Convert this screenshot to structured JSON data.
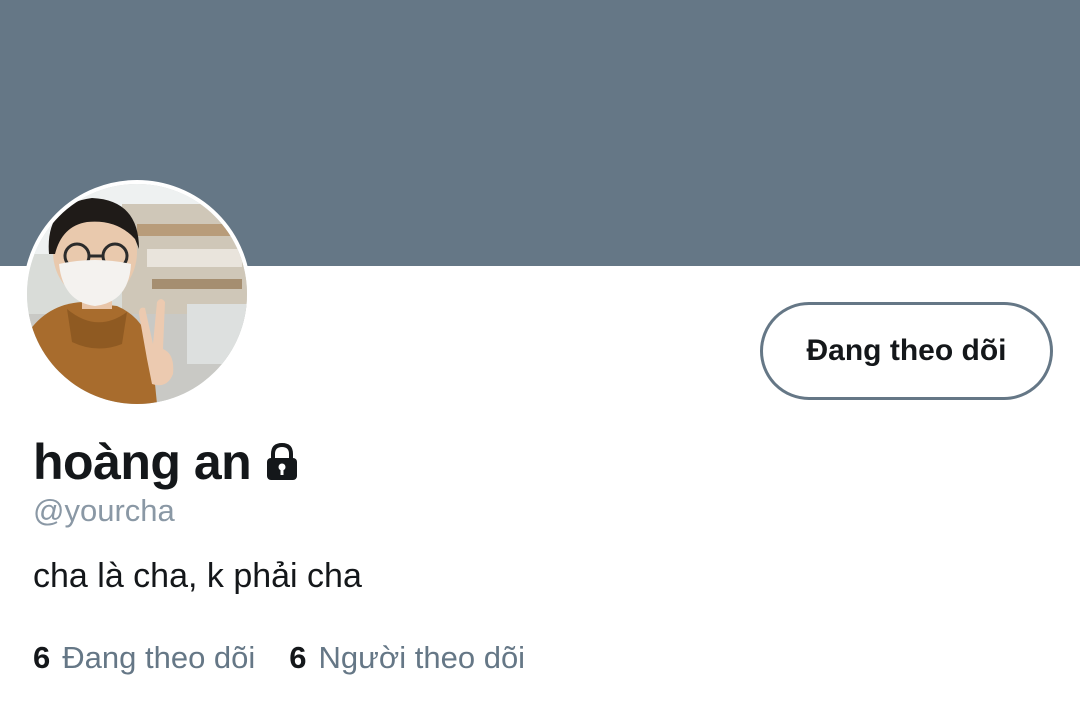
{
  "colors": {
    "banner": "#657786",
    "text_primary": "#14171a",
    "text_secondary": "#657786",
    "button_border": "#657786"
  },
  "profile": {
    "avatar_icon": "user-photo",
    "display_name": "hoàng an",
    "protected_icon": "lock-icon",
    "handle": "@yourcha",
    "bio": "cha là cha, k phải cha"
  },
  "actions": {
    "follow_button_label": "Đang theo dõi"
  },
  "stats": {
    "following_count": "6",
    "following_label": "Đang theo dõi",
    "followers_count": "6",
    "followers_label": "Người theo dõi"
  }
}
